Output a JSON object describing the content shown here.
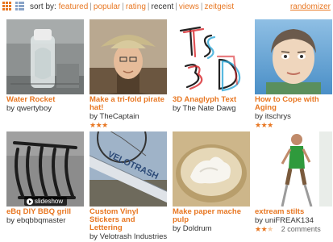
{
  "toolbar": {
    "sort_label": "sort by:",
    "sort_options": [
      "featured",
      "popular",
      "rating",
      "recent",
      "views",
      "zeitgeist"
    ],
    "active_sort": "recent",
    "randomizer": "randomizer"
  },
  "accent_color": "#e87722",
  "projects": [
    {
      "title": "Water Rocket",
      "by_label": "by",
      "author": "qwertyboy",
      "rating": 0,
      "comments": ""
    },
    {
      "title": "Make a tri-fold pirate hat!",
      "by_label": "by",
      "author": "TheCaptain",
      "rating": 3,
      "comments": ""
    },
    {
      "title": "3D Anaglyph Text",
      "by_label": "by",
      "author": "The Nate Dawg",
      "rating": 0,
      "comments": ""
    },
    {
      "title": "How to Cope with Aging",
      "by_label": "by",
      "author": "itschrys",
      "rating": 3,
      "comments": ""
    },
    {
      "title": "eBq DIY BBQ grill",
      "by_label": "by",
      "author": "ebqbbqmaster",
      "rating": 0,
      "comments": "",
      "badge": "slideshow"
    },
    {
      "title": "Custom Vinyl Stickers and Lettering",
      "by_label": "by",
      "author": "Velotrash Industries",
      "rating": 3,
      "comments": ""
    },
    {
      "title": "Make paper mache pulp",
      "by_label": "by",
      "author": "Doldrum",
      "rating": 0,
      "comments": ""
    },
    {
      "title": "extream stilts",
      "by_label": "by",
      "author": "uniFREAK134",
      "rating": 2.5,
      "comments": "2 comments"
    }
  ]
}
